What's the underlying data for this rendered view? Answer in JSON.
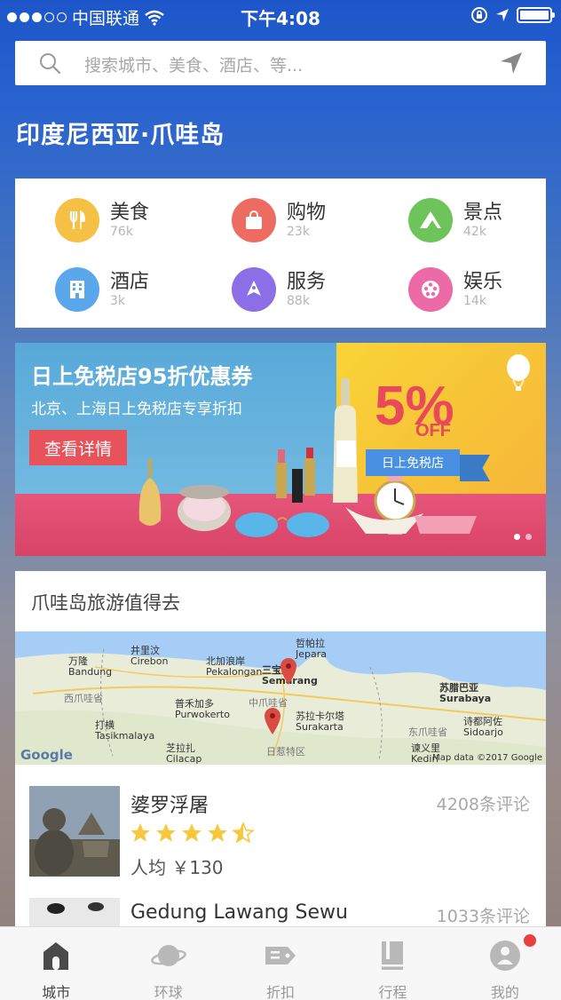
{
  "status_bar": {
    "carrier": "中国联通",
    "time": "下午4:08"
  },
  "search": {
    "placeholder": "搜索城市、美食、酒店、等..."
  },
  "region_title": "印度尼西亚·爪哇岛",
  "categories": [
    {
      "label": "美食",
      "count": "76k",
      "color": "#f5c044",
      "icon": "fork-knife-icon"
    },
    {
      "label": "购物",
      "count": "23k",
      "color": "#ee6b62",
      "icon": "shopping-bag-icon"
    },
    {
      "label": "景点",
      "count": "42k",
      "color": "#6dc45a",
      "icon": "mountain-icon"
    },
    {
      "label": "酒店",
      "count": "3k",
      "color": "#5aa7ec",
      "icon": "building-icon"
    },
    {
      "label": "服务",
      "count": "88k",
      "color": "#8c6fe6",
      "icon": "service-icon"
    },
    {
      "label": "娱乐",
      "count": "14k",
      "color": "#ec6aa6",
      "icon": "film-reel-icon"
    }
  ],
  "banner": {
    "title": "日上免税店95折优惠券",
    "subtitle": "北京、上海日上免税店专享折扣",
    "button": "查看详情",
    "percent": "5%",
    "off": "OFF",
    "ribbon": "日上免税店"
  },
  "travel": {
    "title": "爪哇岛旅游值得去",
    "map_labels": {
      "bandung": "万隆\nBandung",
      "cirebon": "井里汶\nCirebon",
      "pekalongan": "北加浪岸\nPekalongan",
      "jepara": "哲帕拉\nJepara",
      "semarang": "三宝垄\nSemarang",
      "surabaya": "苏腊巴亚\nSurabaya",
      "purwokerto": "普禾加多\nPurwokerto",
      "surakarta": "苏拉卡尔塔\nSurakarta",
      "tasikmalaya": "打横\nTasikmalaya",
      "sidoarjo": "诗都阿佐\nSidoarjo",
      "cilacap": "芝拉扎\nCilacap",
      "kediri": "谏义里\nKediri",
      "west_java": "西爪哇省",
      "central_java": "中爪哇省",
      "east_java": "东爪哇省",
      "yogya": "日惹特区",
      "google": "Google",
      "map_data": "Map data ©2017 Google"
    },
    "pois": [
      {
        "name": "婆罗浮屠",
        "reviews": "4208条评论",
        "rating": 4.5,
        "price": "人均  ￥130"
      },
      {
        "name": "Gedung Lawang Sewu",
        "reviews": "1033条评论"
      }
    ]
  },
  "tabs": [
    {
      "label": "城市",
      "icon": "home-icon",
      "active": true
    },
    {
      "label": "环球",
      "icon": "planet-icon",
      "active": false
    },
    {
      "label": "折扣",
      "icon": "tag-icon",
      "active": false
    },
    {
      "label": "行程",
      "icon": "book-icon",
      "active": false
    },
    {
      "label": "我的",
      "icon": "profile-icon",
      "active": false
    }
  ]
}
